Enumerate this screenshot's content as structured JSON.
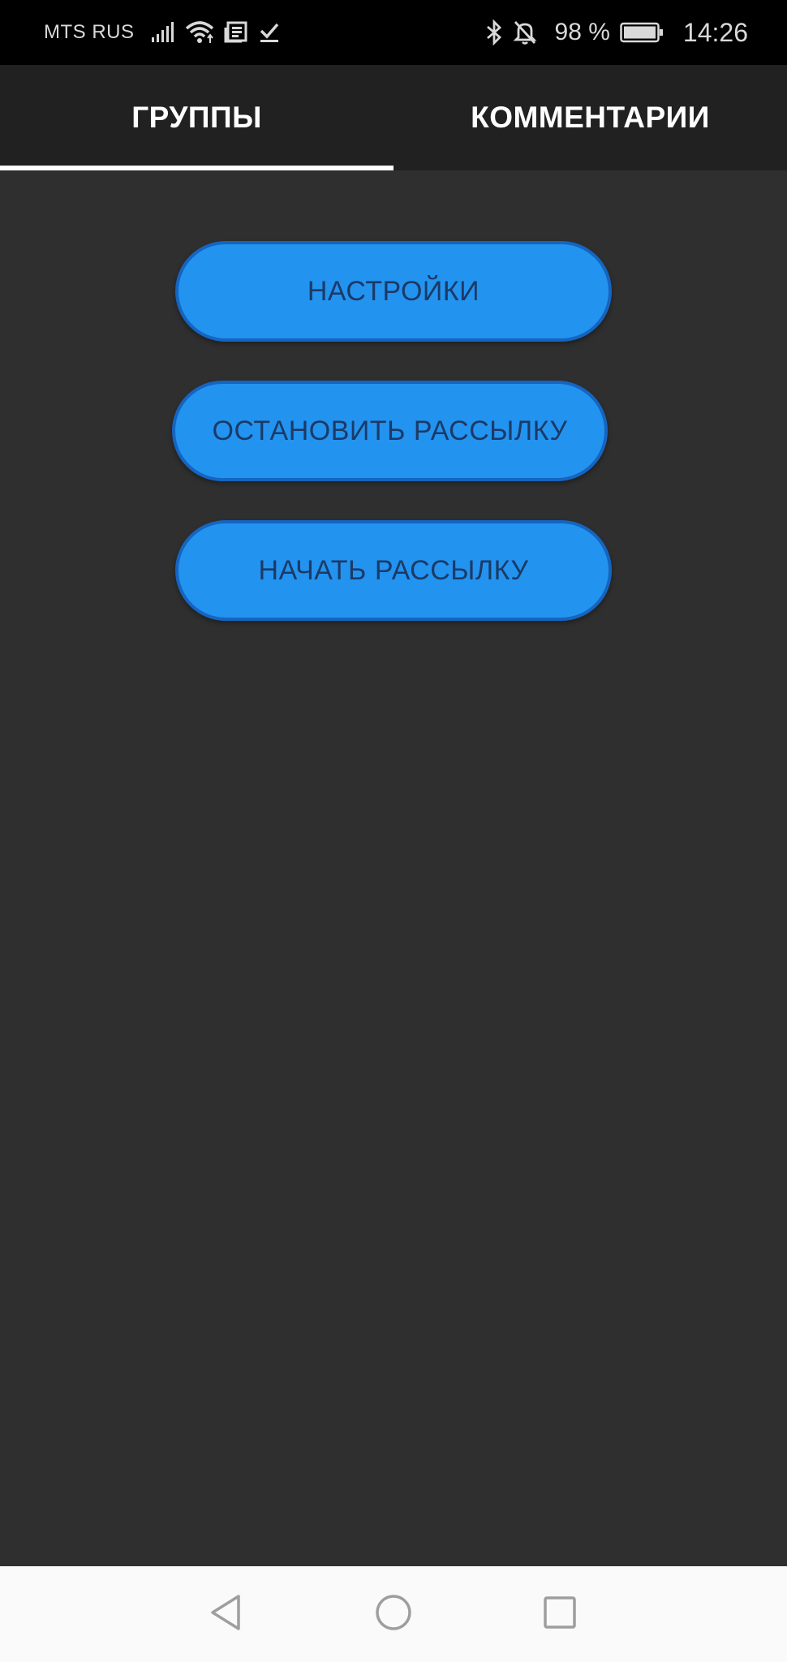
{
  "status_bar": {
    "carrier": "MTS RUS",
    "battery_percent": "98 %",
    "time": "14:26",
    "icons_left": [
      "signal-icon",
      "wifi-icon",
      "news-notification-icon",
      "download-done-icon"
    ],
    "icons_right": [
      "bluetooth-icon",
      "notifications-off-icon",
      "battery-icon"
    ]
  },
  "tabs": [
    {
      "label": "ГРУППЫ",
      "selected": true
    },
    {
      "label": "КОММЕНТАРИИ",
      "selected": false
    }
  ],
  "buttons": {
    "settings": "НАСТРОЙКИ",
    "stop_mailing": "ОСТАНОВИТЬ РАССЫЛКУ",
    "start_mailing": "НАЧАТЬ РАССЫЛКУ"
  },
  "nav_bar": {
    "icons": [
      "back-icon",
      "home-icon",
      "recent-apps-icon"
    ]
  },
  "colors": {
    "status_bar_bg": "#000000",
    "tab_bar_bg": "#212121",
    "content_bg": "#2f2f2f",
    "button_fill": "#2393f0",
    "button_border": "#1565c0",
    "button_text": "#1b3a66",
    "nav_bar_bg": "#fafafa"
  }
}
